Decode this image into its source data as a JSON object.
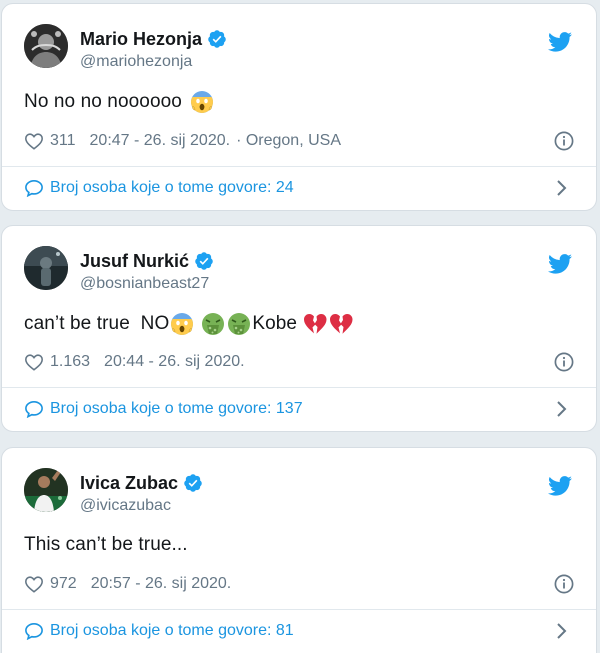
{
  "tweets": [
    {
      "name": "Mario Hezonja",
      "handle": "@mariohezonja",
      "text": "No no no noooooo",
      "likes": "311",
      "timestamp": "20:47 - 26. sij 2020.",
      "location": "· Oregon, USA",
      "conversation": "Broj osoba koje o tome govore: 24",
      "emojis": [
        "scream"
      ]
    },
    {
      "name": "Jusuf Nurkić",
      "handle": "@bosnianbeast27",
      "text_before": "can’t be true  NO",
      "text_after": "Kobe",
      "likes": "1.163",
      "timestamp": "20:44 - 26. sij 2020.",
      "conversation": "Broj osoba koje o tome govore: 137",
      "emojis": [
        "scream",
        "vomit",
        "vomit",
        "broken-heart",
        "broken-heart"
      ]
    },
    {
      "name": "Ivica Zubac",
      "handle": "@ivicazubac",
      "text": "This can’t be true...",
      "likes": "972",
      "timestamp": "20:57 - 26. sij 2020.",
      "conversation": "Broj osoba koje o tome govore: 81"
    }
  ],
  "colors": {
    "twitter_blue": "#1da1f2",
    "link_blue": "#1b95e0",
    "gray": "#657786",
    "broken_heart": "#e0245e"
  },
  "icons": [
    "verified-badge-icon",
    "twitter-bird-icon",
    "heart-icon",
    "info-icon",
    "speech-bubble-icon",
    "chevron-right-icon"
  ]
}
